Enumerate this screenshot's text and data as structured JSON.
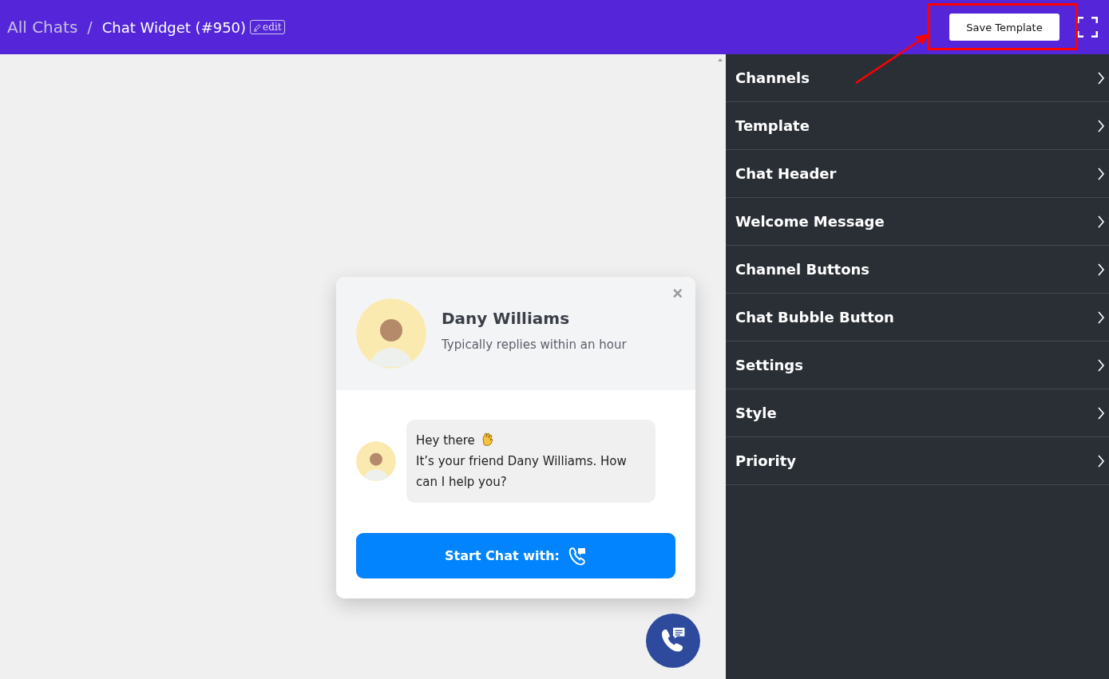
{
  "breadcrumb": {
    "parent": "All Chats",
    "separator": "/",
    "current": "Chat Widget (#950)",
    "edit_label": "edit"
  },
  "toolbar": {
    "save_button": "Save Template"
  },
  "sidebar": {
    "items": [
      {
        "label": "Channels",
        "expanded": false
      },
      {
        "label": "Template",
        "expanded": false
      },
      {
        "label": "Chat Header",
        "expanded": false
      },
      {
        "label": "Welcome Message",
        "expanded": false
      },
      {
        "label": "Channel Buttons",
        "expanded": false
      },
      {
        "label": "Chat Bubble Button",
        "expanded": false
      },
      {
        "label": "Settings",
        "expanded": false
      },
      {
        "label": "Style",
        "expanded": false
      },
      {
        "label": "Priority",
        "expanded": false
      }
    ]
  },
  "widget": {
    "name": "Dany Williams",
    "subtitle": "Typically replies within an hour",
    "close": "×",
    "message_lines": [
      "Hey there",
      "It’s your friend Dany Williams. How can I help you?"
    ],
    "start_button": "Start Chat with:"
  }
}
